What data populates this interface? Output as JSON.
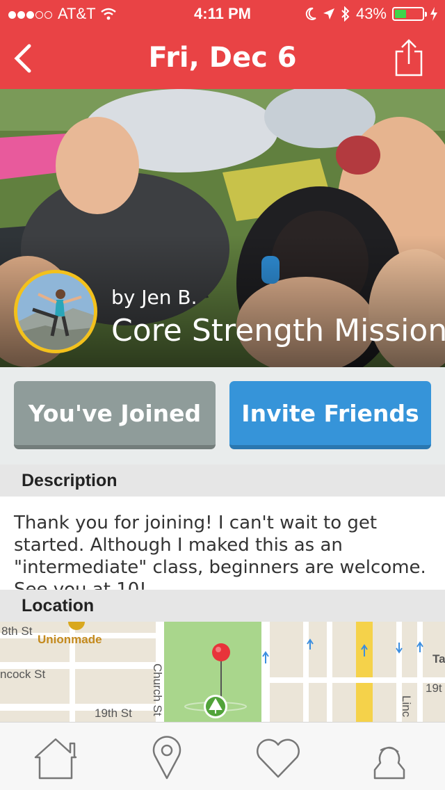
{
  "status_bar": {
    "carrier": "AT&T",
    "time": "4:11 PM",
    "battery": "43%",
    "battery_level": 0.43
  },
  "nav": {
    "title": "Fri, Dec 6",
    "back_icon": "chevron-left-icon",
    "share_icon": "share-icon"
  },
  "event": {
    "author": "by Jen B.",
    "title": "Core Strength Mission"
  },
  "actions": {
    "joined_label": "You've Joined",
    "invite_label": "Invite Friends",
    "joined_color": "#8f9c9a",
    "invite_color": "#3694d9"
  },
  "description": {
    "header": "Description",
    "text": "Thank you for joining! I can't wait to get started. Although I maked this as an \"intermediate\" class, beginners are welcome. See you at 10!"
  },
  "location": {
    "header": "Location",
    "map_labels": {
      "street_18th": "8th St",
      "unionmade": "Unionmade",
      "hancock": "ncock St",
      "church": "Church St",
      "street_19th": "19th St",
      "street_19th_right": "19t",
      "linc": "Linc",
      "ta": "Ta"
    }
  },
  "tabs": [
    {
      "icon": "home-icon"
    },
    {
      "icon": "location-pin-icon"
    },
    {
      "icon": "heart-icon"
    },
    {
      "icon": "profile-icon"
    }
  ],
  "colors": {
    "brand_red": "#e94345",
    "avatar_ring": "#f3c11c"
  }
}
